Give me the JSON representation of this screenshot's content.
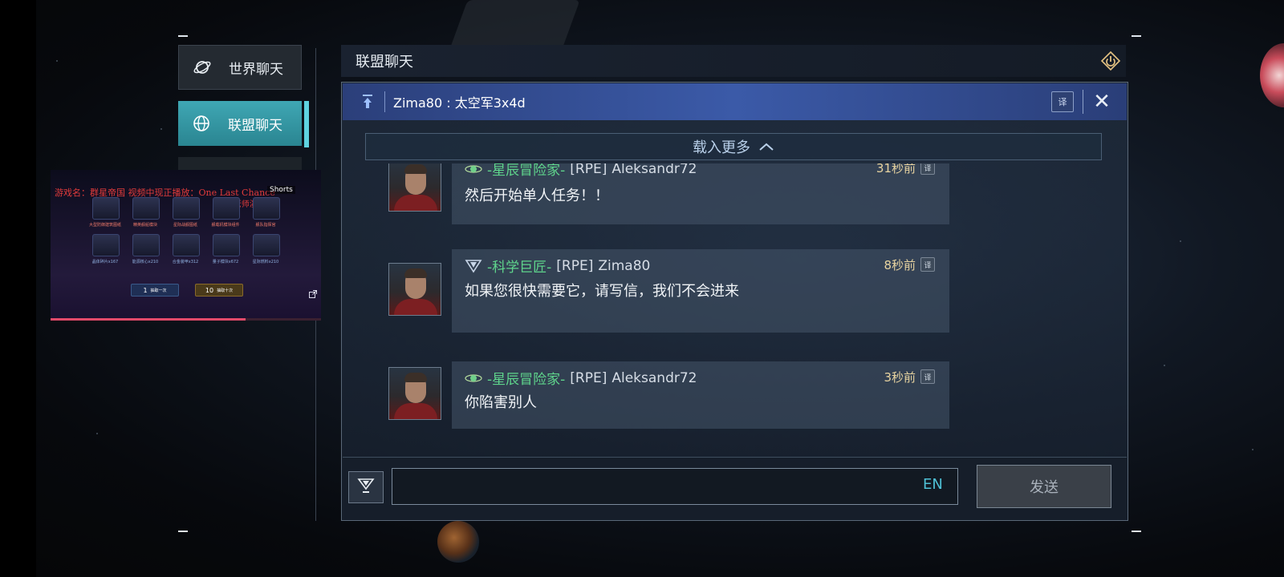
{
  "side_tabs": {
    "world": {
      "label": "世界聊天",
      "icon": "planet-icon"
    },
    "alliance": {
      "label": "联盟聊天",
      "icon": "globe-icon",
      "active": true
    }
  },
  "video": {
    "title": "游戏名：群星帝国  视频中现正播放：One Last Chance",
    "subtitle": "(赫姆老师演唱)",
    "overlay_tag": "Shorts",
    "item_labels_top": [
      "大型防御建筑图纸",
      "精英舰船模块",
      "星际战舰图纸",
      "舰载机模块组件",
      "舰队指挥官"
    ],
    "item_labels_bottom": [
      "晶体碎片x167",
      "能源核心x210",
      "合金装甲x312",
      "量子模块x672",
      "星际燃料x210"
    ],
    "draw_one": {
      "count": "1",
      "label": "抽取一次"
    },
    "draw_ten": {
      "count": "10",
      "label": "抽取十次"
    },
    "progress": 0.72
  },
  "chat": {
    "title": "联盟聊天",
    "pinned": "Zima80 : 太空军3x4d",
    "translate_short": "译",
    "close_symbol": "✕",
    "load_more": "载入更多",
    "messages": [
      {
        "rank": "-星辰冒险家-",
        "tag": "[RPE]",
        "name": "Aleksandr72",
        "time": "31秒前",
        "text": "然后开始单人任务！！",
        "icon": "star-adventurer-icon"
      },
      {
        "rank": "-科学巨匠-",
        "tag": "[RPE]",
        "name": "Zima80",
        "time": "8秒前",
        "text": "如果您很快需要它，请写信，我们不会进来",
        "icon": "science-master-icon"
      },
      {
        "rank": "-星辰冒险家-",
        "tag": "[RPE]",
        "name": "Aleksandr72",
        "time": "3秒前",
        "text": "你陷害别人",
        "icon": "star-adventurer-icon"
      }
    ],
    "input": {
      "value": "",
      "placeholder": "",
      "lang": "EN"
    },
    "send_label": "发送"
  },
  "colors": {
    "accent": "#3fa7b4",
    "rank_green": "#5fd58c",
    "time_gold": "#e7d3a0",
    "pinned_blue": "#3b5aa8"
  }
}
